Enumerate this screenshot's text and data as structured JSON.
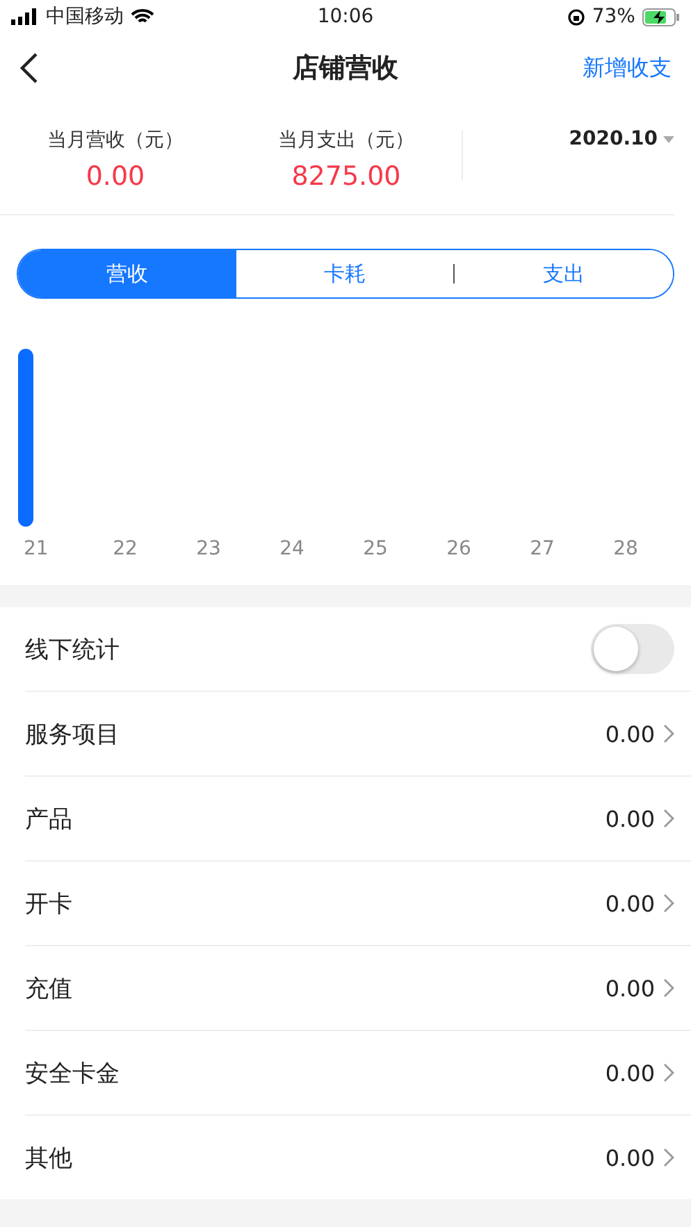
{
  "status_bar": {
    "carrier": "中国移动",
    "time": "10:06",
    "battery": "73%"
  },
  "nav": {
    "title": "店铺营收",
    "action": "新增收支"
  },
  "summary": {
    "items": [
      {
        "label": "当月营收（元）",
        "value": "0.00"
      },
      {
        "label": "当月支出（元）",
        "value": "8275.00"
      }
    ],
    "month": "2020.10"
  },
  "segments": [
    {
      "label": "营收",
      "selected": true
    },
    {
      "label": "卡耗",
      "selected": false
    },
    {
      "label": "支出",
      "selected": false
    }
  ],
  "chart": {
    "days": [
      {
        "label": "21",
        "bar": true
      },
      {
        "label": "22",
        "bar": false
      },
      {
        "label": "23",
        "bar": false
      },
      {
        "label": "24",
        "bar": false
      },
      {
        "label": "25",
        "bar": false
      },
      {
        "label": "26",
        "bar": false
      },
      {
        "label": "27",
        "bar": false
      },
      {
        "label": "28",
        "bar": false
      }
    ]
  },
  "offline": {
    "label": "线下统计",
    "on": false
  },
  "rows": [
    {
      "label": "服务项目",
      "value": "0.00"
    },
    {
      "label": "产品",
      "value": "0.00"
    },
    {
      "label": "开卡",
      "value": "0.00"
    },
    {
      "label": "充值",
      "value": "0.00"
    },
    {
      "label": "安全卡金",
      "value": "0.00"
    },
    {
      "label": "其他",
      "value": "0.00"
    }
  ]
}
